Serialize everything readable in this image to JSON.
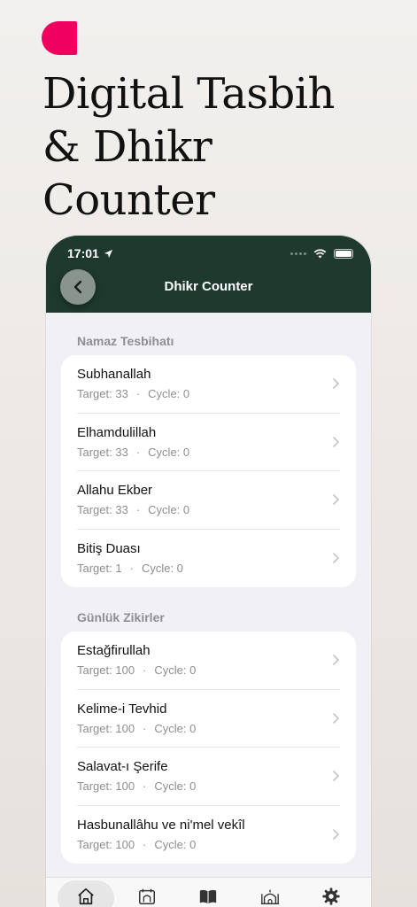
{
  "promo": {
    "headline_lines": [
      "Digital Tasbih",
      "& Dhikr",
      "Counter"
    ],
    "brand_color": "#f0005e"
  },
  "status_bar": {
    "time": "17:01"
  },
  "nav": {
    "title": "Dhikr Counter",
    "back_icon": "chevron-left-icon",
    "bar_color": "#1e3a2f"
  },
  "sections": [
    {
      "header": "Namaz Tesbihatı",
      "items": [
        {
          "title": "Subhanallah",
          "target": "Target: 33",
          "cycle": "Cycle: 0"
        },
        {
          "title": "Elhamdulillah",
          "target": "Target: 33",
          "cycle": "Cycle: 0"
        },
        {
          "title": "Allahu Ekber",
          "target": "Target: 33",
          "cycle": "Cycle: 0"
        },
        {
          "title": "Bitiş Duası",
          "target": "Target: 1",
          "cycle": "Cycle: 0"
        }
      ]
    },
    {
      "header": "Günlük Zikirler",
      "items": [
        {
          "title": "Estağfirullah",
          "target": "Target: 100",
          "cycle": "Cycle: 0"
        },
        {
          "title": "Kelime-i Tevhid",
          "target": "Target: 100",
          "cycle": "Cycle: 0"
        },
        {
          "title": "Salavat-ı Şerife",
          "target": "Target: 100",
          "cycle": "Cycle: 0"
        },
        {
          "title": "Hasbunallâhu ve ni'mel vekîl",
          "target": "Target: 100",
          "cycle": "Cycle: 0"
        }
      ]
    }
  ],
  "separator": "·",
  "tabbar": {
    "tabs": [
      {
        "icon": "home-icon",
        "active": true
      },
      {
        "icon": "calendar-mosque-icon",
        "active": false
      },
      {
        "icon": "book-icon",
        "active": false
      },
      {
        "icon": "mosque-icon",
        "active": false
      },
      {
        "icon": "gear-icon",
        "active": false
      }
    ]
  }
}
